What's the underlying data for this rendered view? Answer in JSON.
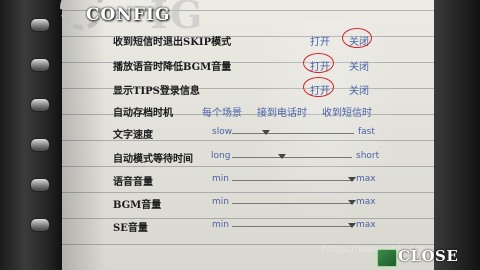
{
  "title": "CONFIG",
  "title_background": "IG",
  "options": [
    {
      "label": "收到短信时退出SKIP模式",
      "choices": [
        "打开",
        "关闭"
      ],
      "selected": "关闭"
    },
    {
      "label": "播放语音时降低BGM音量",
      "choices": [
        "打开",
        "关闭"
      ],
      "selected": "打开"
    },
    {
      "label": "显示TIPS登录信息",
      "choices": [
        "打开",
        "关闭"
      ],
      "selected": "打开"
    },
    {
      "label": "自动存档时机",
      "choices": [
        "每个场景",
        "接到电话时",
        "收到短信时"
      ],
      "selected": ""
    }
  ],
  "sliders": [
    {
      "label": "文字速度",
      "min_label": "slow",
      "max_label": "fast",
      "value": 0.28
    },
    {
      "label": "自动模式等待时间",
      "min_label": "long",
      "max_label": "short",
      "value": 0.42
    },
    {
      "label": "语音音量",
      "min_label": "min",
      "max_label": "max",
      "value": 1.0
    },
    {
      "label": "BGM音量",
      "min_label": "min",
      "max_label": "max",
      "value": 1.0
    },
    {
      "label": "SE音量",
      "min_label": "min",
      "max_label": "max",
      "value": 1.0
    }
  ],
  "close_label": "CLOSE",
  "watermark": "https://www.anju.com",
  "colors": {
    "option_text": "#4a63a8",
    "selection_circle": "#d3202a"
  }
}
